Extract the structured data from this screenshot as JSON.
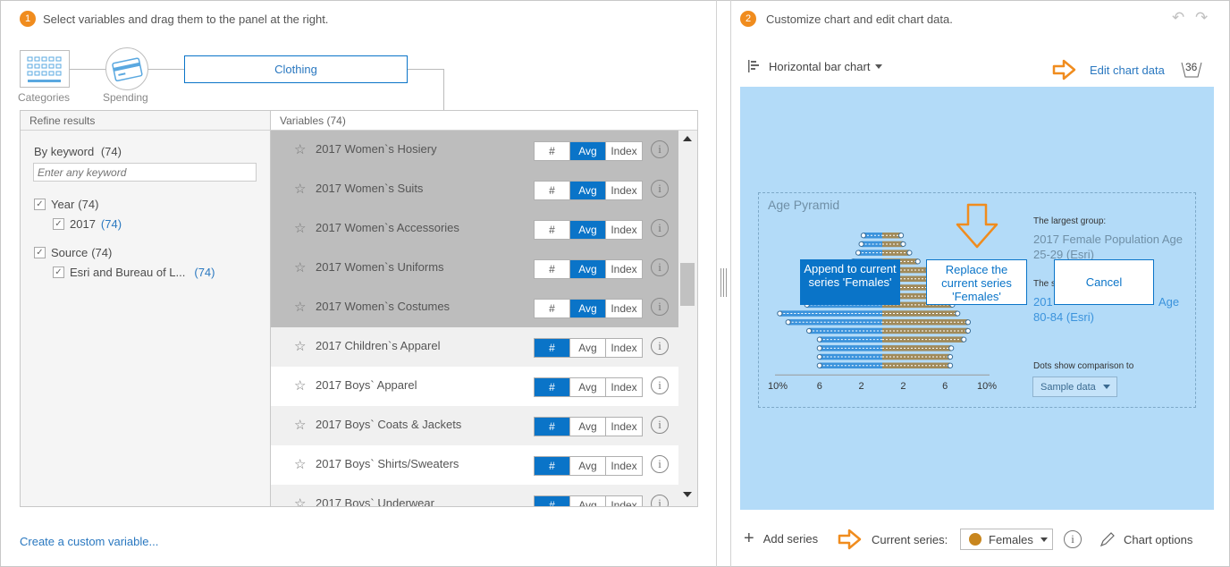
{
  "left": {
    "step_number": "1",
    "step_text": "Select variables and drag them to the panel at the right.",
    "breadcrumb": {
      "categories": "Categories",
      "spending": "Spending",
      "current": "Clothing"
    },
    "refine_header": "Refine results",
    "variables_header": "Variables (74)",
    "keyword_label": "By keyword",
    "keyword_count": "(74)",
    "keyword_placeholder": "Enter any keyword",
    "filters": [
      {
        "label": "Year",
        "count": "(74)"
      },
      {
        "label": "2017",
        "count": "(74)"
      },
      {
        "label": "Source",
        "count": "(74)"
      },
      {
        "label": "Esri and Bureau of L...",
        "count": "(74)"
      }
    ],
    "seg_labels": {
      "num": "#",
      "avg": "Avg",
      "index": "Index"
    },
    "variables": [
      {
        "name": "2017 Women`s Hosiery",
        "selected": "Avg"
      },
      {
        "name": "2017 Women`s Suits",
        "selected": "Avg"
      },
      {
        "name": "2017 Women`s Accessories",
        "selected": "Avg"
      },
      {
        "name": "2017 Women`s Uniforms",
        "selected": "Avg"
      },
      {
        "name": "2017 Women`s Costumes",
        "selected": "Avg"
      },
      {
        "name": "2017 Children`s Apparel",
        "selected": "#"
      },
      {
        "name": "2017 Boys` Apparel",
        "selected": "#"
      },
      {
        "name": "2017 Boys` Coats & Jackets",
        "selected": "#"
      },
      {
        "name": "2017 Boys` Shirts/Sweaters",
        "selected": "#"
      },
      {
        "name": "2017 Boys` Underwear",
        "selected": "#"
      }
    ],
    "custom_link": "Create a custom variable..."
  },
  "right": {
    "step_number": "2",
    "step_text": "Customize chart and edit chart data.",
    "chart_type": "Horizontal bar chart",
    "edit_link": "Edit chart data",
    "edit_count": "36",
    "chart_title": "Age Pyramid",
    "largest_label": "The largest group:",
    "largest_value": "2017 Female Population Age 25-29 (Esri)",
    "smallest_label": "The s",
    "smallest_value_a": "201",
    "smallest_value_b": "Age",
    "smallest_value_c": "80-84 (Esri)",
    "dots_label": "Dots show comparison to",
    "dots_select": "Sample data",
    "append_btn": "Append to current series 'Females'",
    "replace_btn": "Replace the current series 'Females'",
    "cancel_btn": "Cancel",
    "add_series": "Add series",
    "current_series_label": "Current series:",
    "current_series_value": "Females",
    "chart_options": "Chart options",
    "colors": {
      "accent": "#f08c1e",
      "blue": "#0a74c8",
      "chart_bg": "#b3dbf8",
      "male": "#3b93dc",
      "female": "#a08a5a"
    }
  },
  "chart_data": {
    "type": "bar",
    "title": "Age Pyramid",
    "x_tick_labels": [
      "10%",
      "6",
      "2",
      "2",
      "6",
      "10%"
    ],
    "series": [
      {
        "name": "",
        "values": [
          -1.8,
          -2.0,
          -2.3,
          -2.8,
          -3.6,
          -4.6,
          -5.5,
          -6.3,
          -7.2,
          -9.8,
          -9.0,
          -7.0,
          -6.0,
          -6.0,
          -6.0,
          -6.0
        ]
      },
      {
        "name": "Females",
        "values": [
          1.8,
          2.0,
          2.6,
          3.4,
          4.4,
          5.6,
          6.2,
          6.4,
          6.7,
          7.2,
          8.2,
          8.2,
          7.8,
          6.6,
          6.5,
          6.5
        ]
      }
    ],
    "xlim": [
      -10,
      10
    ]
  }
}
